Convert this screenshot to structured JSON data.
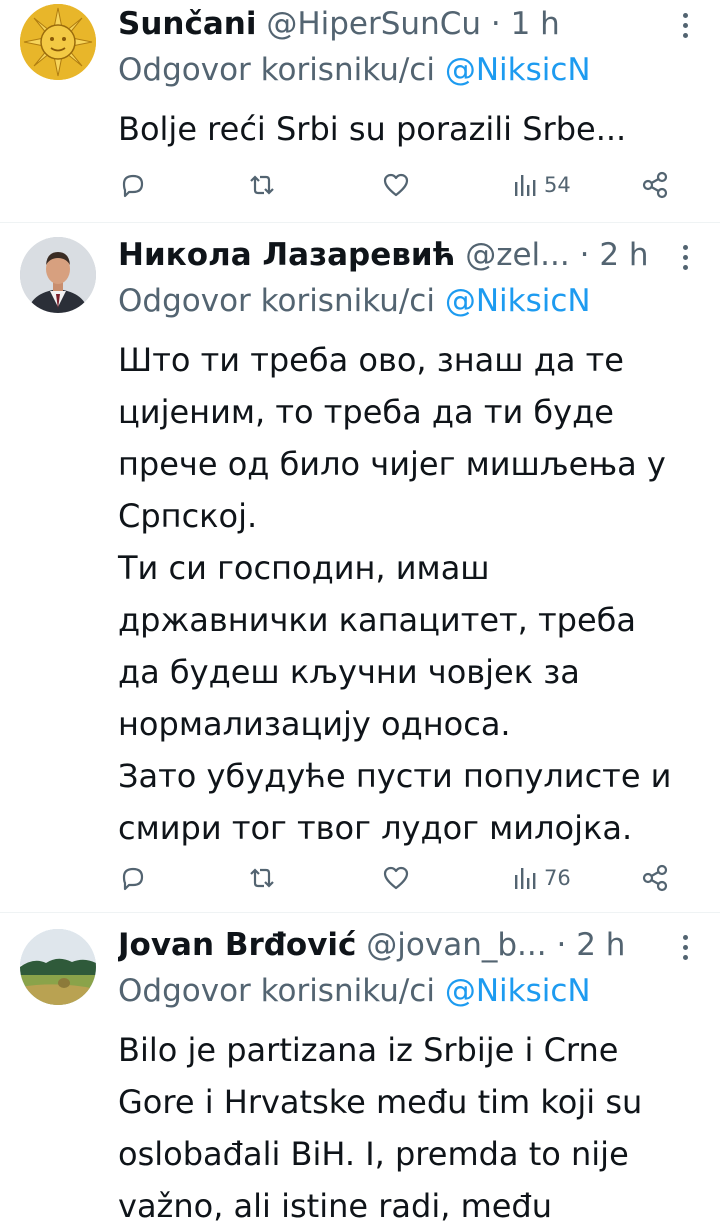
{
  "colors": {
    "text": "#0f1419",
    "muted": "#536471",
    "link": "#1d9bf0",
    "divider": "#eff3f4"
  },
  "tweets": [
    {
      "name": "Sunčani",
      "handle": "@HiperSunCu",
      "separator": "·",
      "time": "1 h",
      "reply_prefix": "Odgovor korisniku/ci",
      "reply_to": "@NiksicN",
      "body": [
        "Bolje reći Srbi su porazili Srbe..."
      ],
      "views": "54",
      "avatar_icon": "sun-emblem-avatar"
    },
    {
      "name": "Никола Лазаревић",
      "handle": "@zel...",
      "separator": "·",
      "time": "2 h",
      "reply_prefix": "Odgovor korisniku/ci",
      "reply_to": "@NiksicN",
      "body": [
        "Што ти треба ово, знаш да те",
        "цијеним, то треба да ти буде",
        "прече од било чијег мишљења у",
        "Српској.",
        "Ти си господин, имаш",
        "државнички капацитет, треба",
        "да будеш  кључни човјек за",
        "нормализацију односа.",
        "Зато убудуће пусти популисте и",
        "смири тог твог лудог милојка."
      ],
      "views": "76",
      "avatar_icon": "man-portrait-avatar"
    },
    {
      "name": "Jovan Brđović",
      "handle": "@jovan_b...",
      "separator": "·",
      "time": "2 h",
      "reply_prefix": "Odgovor korisniku/ci",
      "reply_to": "@NiksicN",
      "body": [
        "Bilo je partizana iz Srbije i Crne",
        "Gore i Hrvatske među tim koji su",
        "oslobađali BiH. I, premda to nije",
        "važno, ali istine radi, među"
      ],
      "avatar_icon": "landscape-avatar"
    }
  ]
}
